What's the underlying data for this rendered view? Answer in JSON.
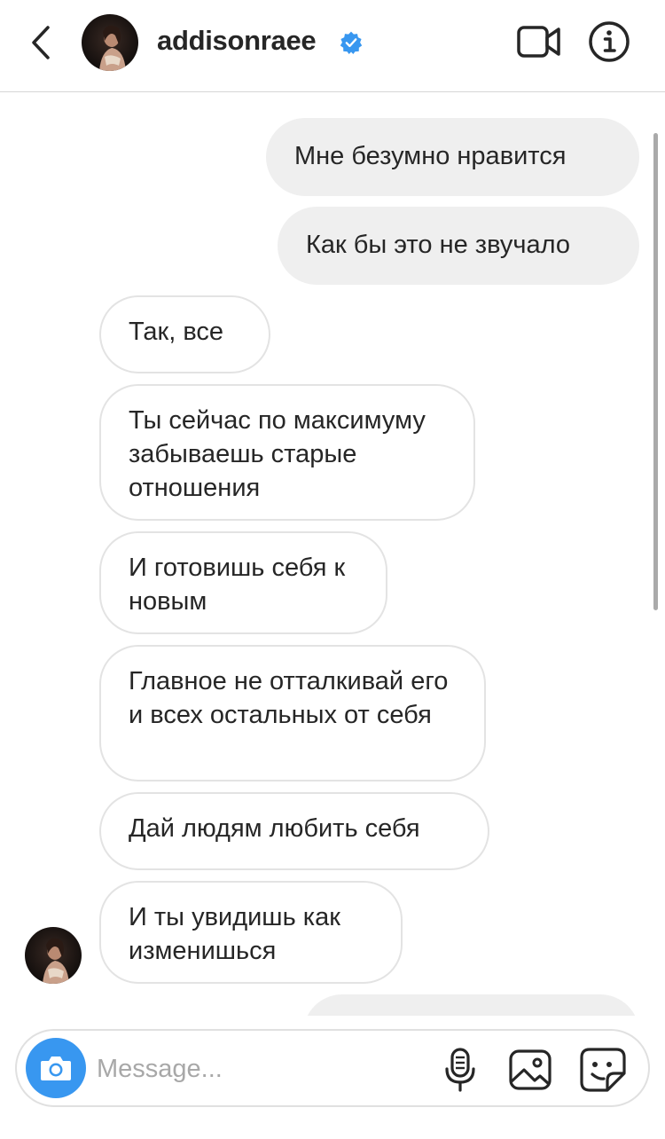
{
  "header": {
    "username": "addisonraee",
    "verified": true,
    "icons": [
      "back-chevron-icon",
      "verified-badge-icon",
      "video-call-icon",
      "info-icon"
    ]
  },
  "thread": {
    "messages": [
      {
        "direction": "outgoing",
        "text": "Мне безумно нравится"
      },
      {
        "direction": "outgoing",
        "text": "Как бы это не звучало"
      },
      {
        "direction": "incoming",
        "text": "Так, все"
      },
      {
        "direction": "incoming",
        "text": "Ты сейчас по максимуму забываешь старые отношения"
      },
      {
        "direction": "incoming",
        "text": "И готовишь себя к новым"
      },
      {
        "direction": "incoming",
        "text": "Главное не отталкивай его и всех остальных от себя"
      },
      {
        "direction": "incoming",
        "text": "Дай людям любить себя"
      },
      {
        "direction": "incoming",
        "text": "И ты увидишь как изменишься"
      }
    ]
  },
  "composer": {
    "placeholder": "Message...",
    "icons": [
      "camera-icon",
      "microphone-icon",
      "gallery-icon",
      "sticker-icon"
    ]
  },
  "colors": {
    "accent": "#3897f0",
    "outgoing_bubble": "#efefef",
    "incoming_border": "#e3e3e3",
    "text": "#262626",
    "placeholder": "#a8a8a8"
  }
}
